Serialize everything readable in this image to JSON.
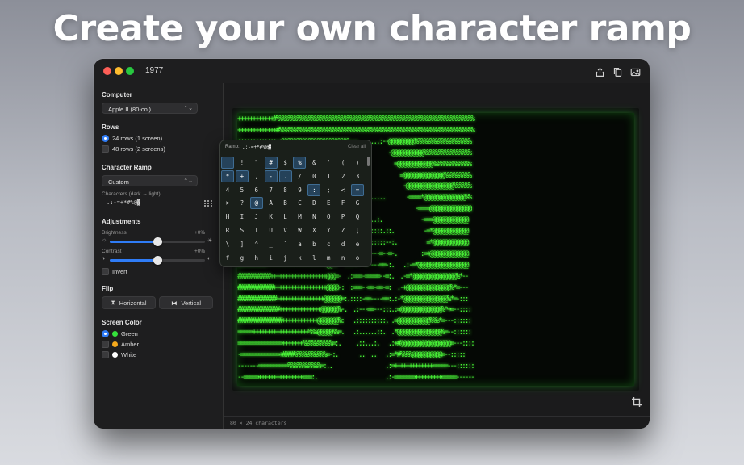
{
  "headline": "Create your own character ramp",
  "window": {
    "title": "1977",
    "toolbar_icons": [
      "share-icon",
      "copy-icon",
      "image-icon"
    ]
  },
  "sidebar": {
    "computer": {
      "label": "Computer",
      "value": "Apple II (80-col)"
    },
    "rows": {
      "label": "Rows",
      "options": [
        {
          "label": "24 rows (1 screen)",
          "selected": true
        },
        {
          "label": "48 rows (2 screens)",
          "selected": false
        }
      ]
    },
    "character_ramp": {
      "label": "Character Ramp",
      "value": "Custom",
      "chars_label": "Characters (dark → light):",
      "chars_value": " .:-=+*#%@▓"
    },
    "adjustments": {
      "label": "Adjustments",
      "brightness": {
        "label": "Brightness",
        "value_text": "+0%",
        "level": 0.5
      },
      "contrast": {
        "label": "Contrast",
        "value_text": "+0%",
        "level": 0.5
      },
      "invert_label": "Invert"
    },
    "flip": {
      "label": "Flip",
      "horizontal": "Horizontal",
      "vertical": "Vertical"
    },
    "screen_color": {
      "label": "Screen Color",
      "options": [
        {
          "label": "Green",
          "color": "#35e13b",
          "selected": true
        },
        {
          "label": "Amber",
          "color": "#f4a91c",
          "selected": false
        },
        {
          "label": "White",
          "color": "#ffffff",
          "selected": false
        }
      ]
    }
  },
  "ramp_popover": {
    "label": "Ramp:",
    "value": " .:-=+*#%@▓",
    "clear": "Clear all",
    "cells": [
      {
        "c": " ",
        "s": true
      },
      {
        "c": "!",
        "s": false
      },
      {
        "c": "\"",
        "s": false
      },
      {
        "c": "#",
        "s": true
      },
      {
        "c": "$",
        "s": false
      },
      {
        "c": "%",
        "s": true
      },
      {
        "c": "&",
        "s": false
      },
      {
        "c": "'",
        "s": false
      },
      {
        "c": "(",
        "s": false
      },
      {
        "c": ")",
        "s": false
      },
      {
        "c": "*",
        "s": true
      },
      {
        "c": "+",
        "s": true
      },
      {
        "c": ",",
        "s": false
      },
      {
        "c": "-",
        "s": true
      },
      {
        "c": ".",
        "s": true
      },
      {
        "c": "/",
        "s": false
      },
      {
        "c": "0",
        "s": false
      },
      {
        "c": "1",
        "s": false
      },
      {
        "c": "2",
        "s": false
      },
      {
        "c": "3",
        "s": false
      },
      {
        "c": "4",
        "s": false
      },
      {
        "c": "5",
        "s": false
      },
      {
        "c": "6",
        "s": false
      },
      {
        "c": "7",
        "s": false
      },
      {
        "c": "8",
        "s": false
      },
      {
        "c": "9",
        "s": false
      },
      {
        "c": ":",
        "s": true
      },
      {
        "c": ";",
        "s": false
      },
      {
        "c": "<",
        "s": false
      },
      {
        "c": "=",
        "s": true
      },
      {
        "c": ">",
        "s": false
      },
      {
        "c": "?",
        "s": false
      },
      {
        "c": "@",
        "s": true
      },
      {
        "c": "A",
        "s": false
      },
      {
        "c": "B",
        "s": false
      },
      {
        "c": "C",
        "s": false
      },
      {
        "c": "D",
        "s": false
      },
      {
        "c": "E",
        "s": false
      },
      {
        "c": "F",
        "s": false
      },
      {
        "c": "G",
        "s": false
      },
      {
        "c": "H",
        "s": false
      },
      {
        "c": "I",
        "s": false
      },
      {
        "c": "J",
        "s": false
      },
      {
        "c": "K",
        "s": false
      },
      {
        "c": "L",
        "s": false
      },
      {
        "c": "M",
        "s": false
      },
      {
        "c": "N",
        "s": false
      },
      {
        "c": "O",
        "s": false
      },
      {
        "c": "P",
        "s": false
      },
      {
        "c": "Q",
        "s": false
      },
      {
        "c": "R",
        "s": false
      },
      {
        "c": "S",
        "s": false
      },
      {
        "c": "T",
        "s": false
      },
      {
        "c": "U",
        "s": false
      },
      {
        "c": "V",
        "s": false
      },
      {
        "c": "W",
        "s": false
      },
      {
        "c": "X",
        "s": false
      },
      {
        "c": "Y",
        "s": false
      },
      {
        "c": "Z",
        "s": false
      },
      {
        "c": "[",
        "s": false
      },
      {
        "c": "\\",
        "s": false
      },
      {
        "c": "]",
        "s": false
      },
      {
        "c": "^",
        "s": false
      },
      {
        "c": "_",
        "s": false
      },
      {
        "c": "`",
        "s": false
      },
      {
        "c": "a",
        "s": false
      },
      {
        "c": "b",
        "s": false
      },
      {
        "c": "c",
        "s": false
      },
      {
        "c": "d",
        "s": false
      },
      {
        "c": "e",
        "s": false
      },
      {
        "c": "f",
        "s": false
      },
      {
        "c": "g",
        "s": false
      },
      {
        "c": "h",
        "s": false
      },
      {
        "c": "i",
        "s": false
      },
      {
        "c": "j",
        "s": false
      },
      {
        "c": "k",
        "s": false
      },
      {
        "c": "l",
        "s": false
      },
      {
        "c": "m",
        "s": false
      },
      {
        "c": "n",
        "s": false
      },
      {
        "c": "o",
        "s": false
      }
    ]
  },
  "screen": {
    "ascii_rows": [
      "++++++++++++#%%%%%%%%%%%%%%%%%%%%%%%%%%%%%%%%%%%%%%%%%%%%%%%%%%%%%%%%%%%%%%%%%%%",
      "+++++++++++++#%%%%%%%%%%%%%%%%%%%%%%%%%%%%%%%%%%%%%%%%%%%%%%%%%%%%%%%%%%%%%%%%%%",
      "+++++++++++++++%%%%%%%%%%%%%%%%%%%%%%%:=:.......:--@@@@@@@@@%%%%%%%%%%%%%%%%%%%",
      "++++++++++++++++%%%%%%%%%%%%%%%%%%%%%%.            -@@@@@@@@@@@%%%%%%%%%%%%%%%%",
      "#+++++++++++++++++%%%%%%%%%%%%%%%%%%%.               =@@@@@@@@@@@@%%%%%%%%%%%%%",
      "##+++++++++++++++++++%%%%%%%%%%%%%%%.                  =@@@@@@@@@@@@@@%%%%%%%%%",
      "###++++++++++++++++++++++%%%%%%%%%%.                    -@@@@@@@@@@@@@@@@%%%%%%",
      "####++++++++++++++++++++++++%%%%%%.         ......       -====*@@@@@@@@@@@@@@%%",
      "#####++++++++++++++++++++++++++%%.                          -====@@@@@@@@@@@@@@",
      "######+++++++++++++++++++++++++#.          ::..:.             -===@@@@@@@@@@@@",
      "#######+++++++++++++++++++++++#.        :--::::::.::.          -=*@@@@@@@@@@@@",
      "########++++++++++++++++++++++#.      .:---:::::::--:.          =*@@@@@@@@@@@@",
      "#########+++++++++++++++++++++@%.   ..:=--=-:---=--=-.        :=+@@@@@@@@@@@@@",
      "##########++++++++++++++++++++@@%:  .::==--=----==-:.   .:-=*@@@@@@@@@@@@@@@@@",
      "###########+++++++++++++++++++@@@=-  .:===-=====--=:.  .-=*@@@@@@@@@@@@@@@%*--",
      "############++++++++++++++++++@@@@-:  :===--==-==-=:  .-+@@@@@@@@@@@@@@@%*=---",
      "#############++++++++++++++++@@@@@@=:.::::-==----==:.:-*@@@@@@@@@@@@@@@%*=-:::",
      "##############++++++++++++++@@@@@@%-.  .:---==---:::.:=@@@@@@@@@@@@@@%*+=--::::",
      "###############++++++++++++@@@@@@@%:   .::::::::::. .=@@@@@@@@@@@%%%*=---::::::",
      "=====+++++++++++++++++++%%%@@@@@%%=.   .:......::.  .*@@@@@@@@@@@@@@@%=--::::::",
      "===============+++++++%%%%%%%%%%=:.     .::...:.   .:+#@@@@@@@@@@@@@@@@@=---::::",
      "-=============+####%%%%%%%%%%%=-:.       ..  ..   .:=*#%%%%@@@@@@@@@@=--:::::",
      "-------==========%%%%%%%%%%%=:..                  .:=+++++++++++++=====---::::::",
      "--=====+++++++++++++++===:.                       .:-=======+++++++++=====------"
    ]
  },
  "status": "80 × 24 characters"
}
